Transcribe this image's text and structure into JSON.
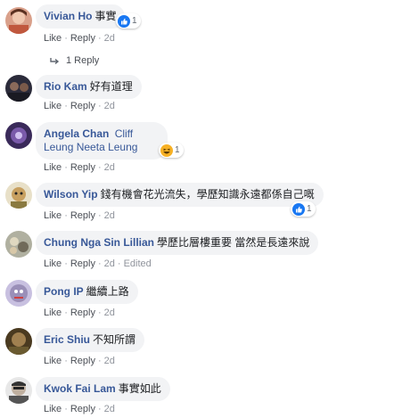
{
  "comments": [
    {
      "author": "Vivian Ho",
      "text": "事實",
      "like": "Like",
      "reply": "Reply",
      "time": "2d",
      "reaction_count": "1",
      "reaction": "like-reaction-icon",
      "avatar_color": "#c0583e"
    },
    {
      "author": "Rio Kam",
      "text": "好有道理",
      "like": "Like",
      "reply": "Reply",
      "time": "2d",
      "avatar_color": "#2b2b3a"
    },
    {
      "author": "Angela Chan",
      "tag1": "Cliff Leung",
      "tag2": "Neeta Leung",
      "like": "Like",
      "reply": "Reply",
      "time": "2d",
      "reaction_count": "1",
      "reaction": "haha-reaction-icon",
      "avatar_color": "#4a3a7a"
    },
    {
      "author": "Wilson Yip",
      "text": "錢有機會花光流失，學歷知識永遠都係自己嘅",
      "like": "Like",
      "reply": "Reply",
      "time": "2d",
      "reaction_count": "1",
      "reaction": "like-reaction-icon",
      "avatar_color": "#8a7a40"
    },
    {
      "author": "Chung Nga Sin Lillian",
      "text": "學歷比層樓重要 當然是長遠來說",
      "like": "Like",
      "reply": "Reply",
      "time": "2d",
      "edited": "Edited",
      "avatar_color": "#9a9a8a"
    },
    {
      "author": "Pong IP",
      "text": "繼續上路",
      "like": "Like",
      "reply": "Reply",
      "time": "2d",
      "avatar_color": "#9a8fb8"
    },
    {
      "author": "Eric Shiu",
      "text": "不知所謂",
      "like": "Like",
      "reply": "Reply",
      "time": "2d",
      "avatar_color": "#6a5a30"
    },
    {
      "author": "Kwok Fai Lam",
      "text": "事實如此",
      "like": "Like",
      "reply": "Reply",
      "time": "2d",
      "avatar_color": "#7a7a7a"
    }
  ],
  "replies_link": "1 Reply",
  "colors": {
    "link": "#385898",
    "bubble": "#f2f3f5",
    "meta": "#90949c",
    "like_blue": "#1877f2",
    "haha_yellow": "#f7b125"
  }
}
